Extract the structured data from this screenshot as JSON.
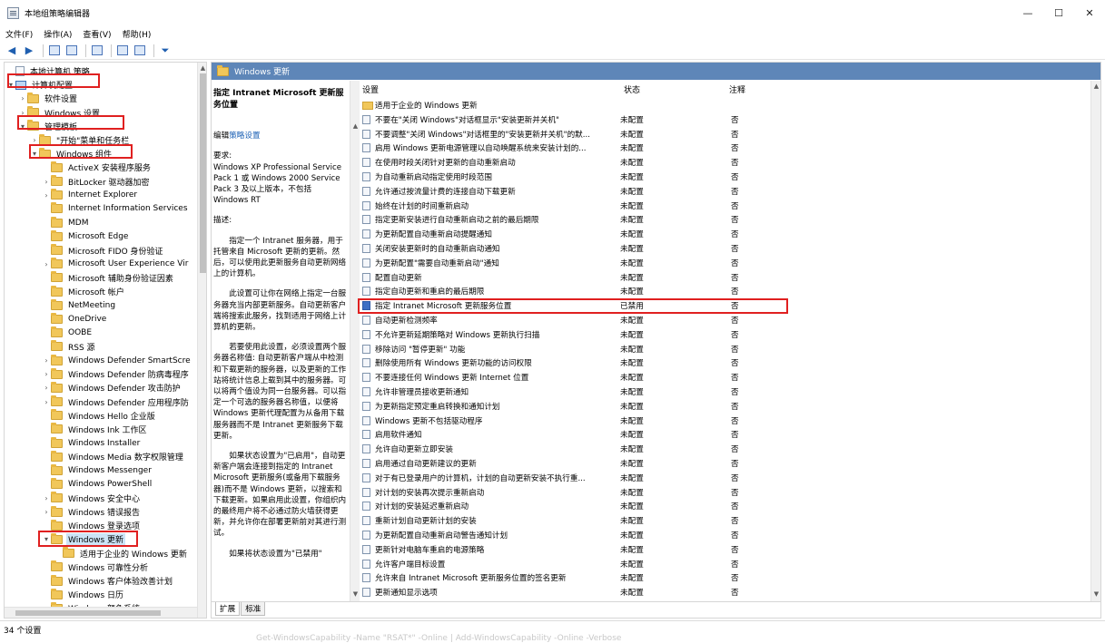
{
  "window": {
    "title": "本地组策略编辑器",
    "minimize": "—",
    "maximize": "☐",
    "close": "✕"
  },
  "menu": [
    "文件(F)",
    "操作(A)",
    "查看(V)",
    "帮助(H)"
  ],
  "tree": {
    "items": [
      {
        "label": "本地计算机 策略",
        "level": 0,
        "arrow": "",
        "icon": "doc"
      },
      {
        "label": "计算机配置",
        "level": 0,
        "arrow": "▾",
        "icon": "pc"
      },
      {
        "label": "软件设置",
        "level": 1,
        "arrow": "›",
        "icon": "folder"
      },
      {
        "label": "Windows 设置",
        "level": 1,
        "arrow": "›",
        "icon": "folder"
      },
      {
        "label": "管理模板",
        "level": 1,
        "arrow": "▾",
        "icon": "folder"
      },
      {
        "label": "\"开始\"菜单和任务栏",
        "level": 2,
        "arrow": "›",
        "icon": "folder"
      },
      {
        "label": "Windows 组件",
        "level": 2,
        "arrow": "▾",
        "icon": "folder"
      },
      {
        "label": "ActiveX 安装程序服务",
        "level": 3,
        "arrow": "",
        "icon": "folder"
      },
      {
        "label": "BitLocker 驱动器加密",
        "level": 3,
        "arrow": "›",
        "icon": "folder"
      },
      {
        "label": "Internet Explorer",
        "level": 3,
        "arrow": "›",
        "icon": "folder"
      },
      {
        "label": "Internet Information Services",
        "level": 3,
        "arrow": "",
        "icon": "folder"
      },
      {
        "label": "MDM",
        "level": 3,
        "arrow": "",
        "icon": "folder"
      },
      {
        "label": "Microsoft Edge",
        "level": 3,
        "arrow": "",
        "icon": "folder"
      },
      {
        "label": "Microsoft FIDO 身份验证",
        "level": 3,
        "arrow": "",
        "icon": "folder"
      },
      {
        "label": "Microsoft User Experience Vir",
        "level": 3,
        "arrow": "›",
        "icon": "folder"
      },
      {
        "label": "Microsoft 辅助身份验证因素",
        "level": 3,
        "arrow": "",
        "icon": "folder"
      },
      {
        "label": "Microsoft 帐户",
        "level": 3,
        "arrow": "",
        "icon": "folder"
      },
      {
        "label": "NetMeeting",
        "level": 3,
        "arrow": "",
        "icon": "folder"
      },
      {
        "label": "OneDrive",
        "level": 3,
        "arrow": "",
        "icon": "folder"
      },
      {
        "label": "OOBE",
        "level": 3,
        "arrow": "",
        "icon": "folder"
      },
      {
        "label": "RSS 源",
        "level": 3,
        "arrow": "",
        "icon": "folder"
      },
      {
        "label": "Windows Defender SmartScre",
        "level": 3,
        "arrow": "›",
        "icon": "folder"
      },
      {
        "label": "Windows Defender 防病毒程序",
        "level": 3,
        "arrow": "›",
        "icon": "folder"
      },
      {
        "label": "Windows Defender 攻击防护",
        "level": 3,
        "arrow": "›",
        "icon": "folder"
      },
      {
        "label": "Windows Defender 应用程序防",
        "level": 3,
        "arrow": "›",
        "icon": "folder"
      },
      {
        "label": "Windows Hello 企业版",
        "level": 3,
        "arrow": "",
        "icon": "folder"
      },
      {
        "label": "Windows Ink 工作区",
        "level": 3,
        "arrow": "",
        "icon": "folder"
      },
      {
        "label": "Windows Installer",
        "level": 3,
        "arrow": "",
        "icon": "folder"
      },
      {
        "label": "Windows Media 数字权限管理",
        "level": 3,
        "arrow": "",
        "icon": "folder"
      },
      {
        "label": "Windows Messenger",
        "level": 3,
        "arrow": "",
        "icon": "folder"
      },
      {
        "label": "Windows PowerShell",
        "level": 3,
        "arrow": "",
        "icon": "folder"
      },
      {
        "label": "Windows 安全中心",
        "level": 3,
        "arrow": "›",
        "icon": "folder"
      },
      {
        "label": "Windows 错误报告",
        "level": 3,
        "arrow": "›",
        "icon": "folder"
      },
      {
        "label": "Windows 登录选项",
        "level": 3,
        "arrow": "",
        "icon": "folder"
      },
      {
        "label": "Windows 更新",
        "level": 3,
        "arrow": "▾",
        "icon": "folder",
        "selected": true
      },
      {
        "label": "适用于企业的 Windows 更新",
        "level": 4,
        "arrow": "",
        "icon": "folder"
      },
      {
        "label": "Windows 可靠性分析",
        "level": 3,
        "arrow": "",
        "icon": "folder"
      },
      {
        "label": "Windows 客户体验改善计划",
        "level": 3,
        "arrow": "",
        "icon": "folder"
      },
      {
        "label": "Windows 日历",
        "level": 3,
        "arrow": "",
        "icon": "folder"
      },
      {
        "label": "Windows 颜色系统",
        "level": 3,
        "arrow": "",
        "icon": "folder"
      }
    ]
  },
  "right": {
    "header": "Windows 更新",
    "desc": {
      "title": "指定 Intranet Microsoft 更新服务位置",
      "edit_prefix": "编辑",
      "edit_link": "策略设置",
      "req_head": "要求:",
      "req_body": "Windows XP Professional Service Pack 1 或 Windows 2000 Service Pack 3 及以上版本，不包括 Windows RT",
      "desc_head": "描述:",
      "paras": [
        "指定一个 Intranet 服务器，用于托管来自 Microsoft 更新的更新。然后，可以使用此更新服务自动更新网络上的计算机。",
        "此设置可让你在网络上指定一台服务器充当内部更新服务。自动更新客户端将搜索此服务，找到适用于网络上计算机的更新。",
        "若要使用此设置，必须设置两个服务器名称值: 自动更新客户端从中检测和下载更新的服务器，以及更新的工作站将统计信息上载到其中的服务器。可以将两个值设为同一台服务器。可以指定一个可选的服务器名称值，以便将 Windows 更新代理配置为从备用下载服务器而不是 Intranet 更新服务下载更新。",
        "如果状态设置为\"已启用\"，自动更新客户端会连接到指定的 Intranet Microsoft 更新服务(或备用下载服务器)而不是 Windows 更新，以搜索和下载更新。如果启用此设置，你组织内的最终用户将不必通过防火墙获得更新，并允许你在部署更新前对其进行测试。",
        "如果将状态设置为\"已禁用\""
      ]
    },
    "columns": {
      "setting": "设置",
      "status": "状态",
      "comment": "注释"
    },
    "rows": [
      {
        "name": "适用于企业的 Windows 更新",
        "status": "",
        "comment": "",
        "kind": "folder"
      },
      {
        "name": "不要在\"关闭 Windows\"对话框显示\"安装更新并关机\"",
        "status": "未配置",
        "comment": "否"
      },
      {
        "name": "不要调整\"关闭 Windows\"对话框里的\"安装更新并关机\"的默...",
        "status": "未配置",
        "comment": "否"
      },
      {
        "name": "启用 Windows 更新电源管理以自动唤醒系统来安装计划的...",
        "status": "未配置",
        "comment": "否"
      },
      {
        "name": "在使用时段关闭针对更新的自动重新启动",
        "status": "未配置",
        "comment": "否"
      },
      {
        "name": "为自动重新启动指定使用时段范围",
        "status": "未配置",
        "comment": "否"
      },
      {
        "name": "允许通过按流量计费的连接自动下载更新",
        "status": "未配置",
        "comment": "否"
      },
      {
        "name": "始终在计划的时间重新启动",
        "status": "未配置",
        "comment": "否"
      },
      {
        "name": "指定更新安装进行自动重新启动之前的最后期限",
        "status": "未配置",
        "comment": "否"
      },
      {
        "name": "为更新配置自动重新启动提醒通知",
        "status": "未配置",
        "comment": "否"
      },
      {
        "name": "关闭安装更新时的自动重新启动通知",
        "status": "未配置",
        "comment": "否"
      },
      {
        "name": "为更新配置\"需要自动重新启动\"通知",
        "status": "未配置",
        "comment": "否"
      },
      {
        "name": "配置自动更新",
        "status": "未配置",
        "comment": "否"
      },
      {
        "name": "指定自动更新和重启的最后期限",
        "status": "未配置",
        "comment": "否"
      },
      {
        "name": "指定 Intranet Microsoft 更新服务位置",
        "status": "已禁用",
        "comment": "否",
        "kind": "on"
      },
      {
        "name": "自动更新检测频率",
        "status": "未配置",
        "comment": "否"
      },
      {
        "name": "不允许更新延期策略对 Windows 更新执行扫描",
        "status": "未配置",
        "comment": "否"
      },
      {
        "name": "移除访问 \"暂停更新\" 功能",
        "status": "未配置",
        "comment": "否"
      },
      {
        "name": "删除使用所有 Windows 更新功能的访问权限",
        "status": "未配置",
        "comment": "否"
      },
      {
        "name": "不要连接任何 Windows 更新 Internet 位置",
        "status": "未配置",
        "comment": "否"
      },
      {
        "name": "允许非管理员接收更新通知",
        "status": "未配置",
        "comment": "否"
      },
      {
        "name": "为更新指定预定重启转换和通知计划",
        "status": "未配置",
        "comment": "否"
      },
      {
        "name": "Windows 更新不包括驱动程序",
        "status": "未配置",
        "comment": "否"
      },
      {
        "name": "启用软件通知",
        "status": "未配置",
        "comment": "否"
      },
      {
        "name": "允许自动更新立即安装",
        "status": "未配置",
        "comment": "否"
      },
      {
        "name": "启用通过自动更新建议的更新",
        "status": "未配置",
        "comment": "否"
      },
      {
        "name": "对于有已登录用户的计算机，计划的自动更新安装不执行重...",
        "status": "未配置",
        "comment": "否"
      },
      {
        "name": "对计划的安装再次提示重新启动",
        "status": "未配置",
        "comment": "否"
      },
      {
        "name": "对计划的安装延迟重新启动",
        "status": "未配置",
        "comment": "否"
      },
      {
        "name": "重新计划自动更新计划的安装",
        "status": "未配置",
        "comment": "否"
      },
      {
        "name": "为更新配置自动重新启动警告通知计划",
        "status": "未配置",
        "comment": "否"
      },
      {
        "name": "更新针对电脑车重启的电源策略",
        "status": "未配置",
        "comment": "否"
      },
      {
        "name": "允许客户端目标设置",
        "status": "未配置",
        "comment": "否"
      },
      {
        "name": "允许来自 Intranet Microsoft 更新服务位置的签名更新",
        "status": "未配置",
        "comment": "否"
      },
      {
        "name": "更新通知显示选项",
        "status": "未配置",
        "comment": "否"
      }
    ],
    "tabs": [
      "扩展",
      "标准"
    ]
  },
  "status": {
    "count": "34 个设置",
    "ghost": "Get-WindowsCapability -Name \"RSAT*\" -Online | Add-WindowsCapability -Online -Verbose"
  },
  "colors": {
    "header_bg": "#5e86b8",
    "highlight": "#e02020",
    "link": "#1a5fb4"
  }
}
